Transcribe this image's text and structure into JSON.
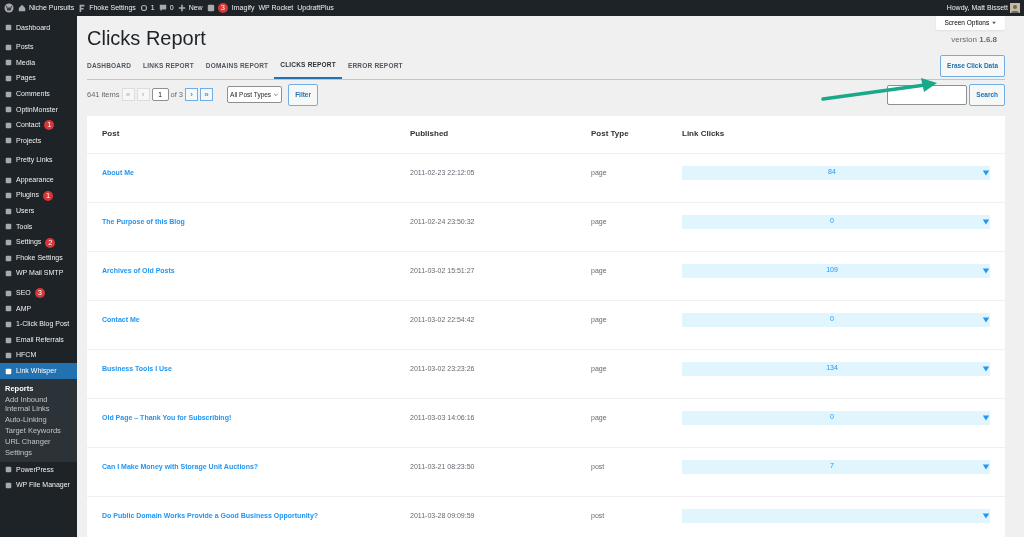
{
  "admin_bar": {
    "site": "Niche Pursuits",
    "items": [
      {
        "kind": "fhoke",
        "label": "Fhoke Settings"
      },
      {
        "kind": "updates",
        "label": "1"
      },
      {
        "kind": "comments",
        "label": "0"
      },
      {
        "kind": "new",
        "label": "New"
      },
      {
        "kind": "yoast",
        "badge": "3"
      },
      {
        "kind": "text",
        "label": "Imagify"
      },
      {
        "kind": "text",
        "label": "WP Rocket"
      },
      {
        "kind": "text",
        "label": "UpdraftPlus"
      }
    ],
    "greeting": "Howdy, Matt Bissett"
  },
  "sidebar": {
    "items": [
      {
        "label": "Dashboard",
        "selected": false
      },
      {
        "label": "Posts",
        "selected": false,
        "gap": true
      },
      {
        "label": "Media",
        "selected": false
      },
      {
        "label": "Pages",
        "selected": false
      },
      {
        "label": "Comments",
        "selected": false
      },
      {
        "label": "OptinMonster",
        "selected": false
      },
      {
        "label": "Contact",
        "badge": "1",
        "selected": false
      },
      {
        "label": "Projects",
        "selected": false
      },
      {
        "label": "Pretty Links",
        "selected": false,
        "gap": true
      },
      {
        "label": "Appearance",
        "selected": false,
        "gap": true
      },
      {
        "label": "Plugins",
        "badge": "1",
        "selected": false
      },
      {
        "label": "Users",
        "selected": false
      },
      {
        "label": "Tools",
        "selected": false
      },
      {
        "label": "Settings",
        "badge": "2",
        "selected": false
      },
      {
        "label": "Fhoke Settings",
        "selected": false
      },
      {
        "label": "WP Mail SMTP",
        "selected": false
      },
      {
        "label": "SEO",
        "badge": "3",
        "selected": false,
        "gap": true
      },
      {
        "label": "AMP",
        "selected": false
      },
      {
        "label": "1-Click Blog Post",
        "selected": false
      },
      {
        "label": "Email Referrals",
        "selected": false
      },
      {
        "label": "HFCM",
        "selected": false
      },
      {
        "label": "Link Whisper",
        "selected": true,
        "children": [
          {
            "label": "Reports",
            "selected": true
          },
          {
            "label": "Add Inbound Internal Links",
            "selected": false
          },
          {
            "label": "Auto-Linking",
            "selected": false
          },
          {
            "label": "Target Keywords",
            "selected": false
          },
          {
            "label": "URL Changer",
            "selected": false
          },
          {
            "label": "Settings",
            "selected": false
          }
        ]
      },
      {
        "label": "PowerPress",
        "selected": false
      },
      {
        "label": "WP File Manager",
        "selected": false
      }
    ]
  },
  "screen_options": "Screen Options",
  "title": "Clicks Report",
  "version": {
    "label": "version",
    "number": "1.6.8"
  },
  "tabs": [
    {
      "label": "DASHBOARD",
      "selected": false
    },
    {
      "label": "LINKS REPORT",
      "selected": false
    },
    {
      "label": "DOMAINS REPORT",
      "selected": false
    },
    {
      "label": "CLICKS REPORT",
      "selected": true
    },
    {
      "label": "ERROR REPORT",
      "selected": false
    }
  ],
  "erase_button": "Erase Click Data",
  "pagination": {
    "count": "641 items",
    "first": "«",
    "prev": "‹",
    "page": "1",
    "of": "of 3",
    "next": "›",
    "last": "»"
  },
  "post_type_filter": "All Post Types",
  "filter_button": "Filter",
  "search_button": "Search",
  "table": {
    "columns": [
      "Post",
      "Published",
      "Post Type",
      "Link Clicks"
    ],
    "rows": [
      {
        "post": "About Me",
        "published": "2011-02-23 22:12:05",
        "type": "page",
        "clicks": "84"
      },
      {
        "post": "The Purpose of this Blog",
        "published": "2011-02-24 23:50:32",
        "type": "page",
        "clicks": "0"
      },
      {
        "post": "Archives of Old Posts",
        "published": "2011-03-02 15:51:27",
        "type": "page",
        "clicks": "109"
      },
      {
        "post": "Contact Me",
        "published": "2011-03-02 22:54:42",
        "type": "page",
        "clicks": "0"
      },
      {
        "post": "Business Tools I Use",
        "published": "2011-03-02 23:23:26",
        "type": "page",
        "clicks": "134"
      },
      {
        "post": "Old Page – Thank You for Subscribing!",
        "published": "2011-03-03 14:06:16",
        "type": "page",
        "clicks": "0"
      },
      {
        "post": "Can I Make Money with Storage Unit Auctions?",
        "published": "2011-03-21 08:23:50",
        "type": "post",
        "clicks": "7"
      },
      {
        "post": "Do Public Domain Works Provide a Good Business Opportunity?",
        "published": "2011-03-28 09:09:59",
        "type": "post"
      }
    ]
  }
}
